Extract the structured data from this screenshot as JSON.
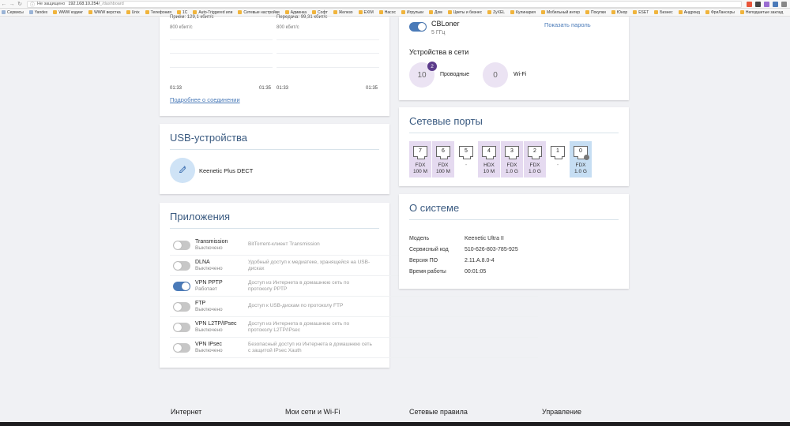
{
  "browser": {
    "insecure_label": "Не защищено",
    "url_host": "192.168.10.254/",
    "url_path": "_/dashboard",
    "bookmarks": [
      "Сервисы",
      "Yandex",
      "WWW кодинг",
      "WWW верстка",
      "Unix",
      "Телефония",
      "1С",
      "Auto-Triggered или",
      "Сетевые настройки",
      "Админка",
      "Софт",
      "Железо",
      "EXIM",
      "Насос",
      "Игрульки",
      "Дом",
      "Цветы и бизнес",
      "ZyXEL",
      "Кулинария",
      "Мобильный интер",
      "Покупки",
      "Юнор",
      "ESET",
      "Бизнес",
      "Андроид",
      "ФриЛансеры",
      "Неподшитые заклад"
    ]
  },
  "traffic": {
    "left": {
      "header": "Приём: 129,1 кбит/с",
      "scale": "800 кбит/с",
      "t_start": "01:33",
      "t_end": "01:35"
    },
    "right": {
      "header": "Передача: 99,31 кбит/с",
      "scale": "800 кбит/с",
      "t_start": "01:33",
      "t_end": "01:35"
    },
    "details_link": "Подробнее о соединении"
  },
  "usb": {
    "title": "USB-устройства",
    "device": "Keenetic Plus DECT"
  },
  "apps": {
    "title": "Приложения",
    "items": [
      {
        "name": "Transmission",
        "state": "Выключено",
        "desc": "BitTorrent-клиент Transmission",
        "on": false
      },
      {
        "name": "DLNA",
        "state": "Выключено",
        "desc": "Удобный доступ к медиатеке, хранящейся на USB-дисках",
        "on": false
      },
      {
        "name": "VPN PPTP",
        "state": "Работает",
        "desc": "Доступ из Интернета в домашнюю сеть по протоколу PPTP",
        "on": true
      },
      {
        "name": "FTP",
        "state": "Выключено",
        "desc": "Доступ к USB-дискам по протоколу FTP",
        "on": false
      },
      {
        "name": "VPN L2TP/IPsec",
        "state": "Выключено",
        "desc": "Доступ из Интернета в домашнюю сеть по протоколу L2TP/IPsec",
        "on": false
      },
      {
        "name": "VPN IPsec",
        "state": "Выключено",
        "desc": "Безопасный доступ из Интернета в домашнюю сеть с защитой IPsec Xauth",
        "on": false
      }
    ]
  },
  "wifi": {
    "ssid": "CBLoner",
    "band": "5 ГГц",
    "enabled": true,
    "show_password": "Показать пароль"
  },
  "devices": {
    "title": "Устройства в сети",
    "wired_count": "10",
    "wired_badge": "2",
    "wired_label": "Проводные",
    "wifi_count": "0",
    "wifi_label": "Wi-Fi"
  },
  "ports": {
    "title": "Сетевые порты",
    "items": [
      {
        "num": "7",
        "l1": "FDX",
        "l2": "100 M",
        "state": "active"
      },
      {
        "num": "6",
        "l1": "FDX",
        "l2": "100 M",
        "state": "active"
      },
      {
        "num": "5",
        "l1": "-",
        "l2": "",
        "state": "down"
      },
      {
        "num": "4",
        "l1": "HDX",
        "l2": "10 M",
        "state": "active"
      },
      {
        "num": "3",
        "l1": "FDX",
        "l2": "1.0 G",
        "state": "active"
      },
      {
        "num": "2",
        "l1": "FDX",
        "l2": "1.0 G",
        "state": "active"
      },
      {
        "num": "1",
        "l1": "-",
        "l2": "",
        "state": "down"
      },
      {
        "num": "0",
        "l1": "FDX",
        "l2": "1.0 G",
        "state": "wan"
      }
    ]
  },
  "system": {
    "title": "О системе",
    "rows": [
      {
        "k": "Модель",
        "v": "Keenetic Ultra II"
      },
      {
        "k": "Сервисный код",
        "v": "510-626-803-785-925"
      },
      {
        "k": "Версия ПО",
        "v": "2.11.A.8.0-4"
      },
      {
        "k": "Время работы",
        "v": "00:01:05"
      }
    ]
  },
  "footer": [
    "Интернет",
    "Мои сети и Wi-Fi",
    "Сетевые правила",
    "Управление"
  ],
  "colors": {
    "accent": "#4a7ab8",
    "title": "#3a5a80",
    "port_active": "#e5daf0",
    "port_wan": "#c6def3",
    "badge": "#5b3b8a"
  }
}
